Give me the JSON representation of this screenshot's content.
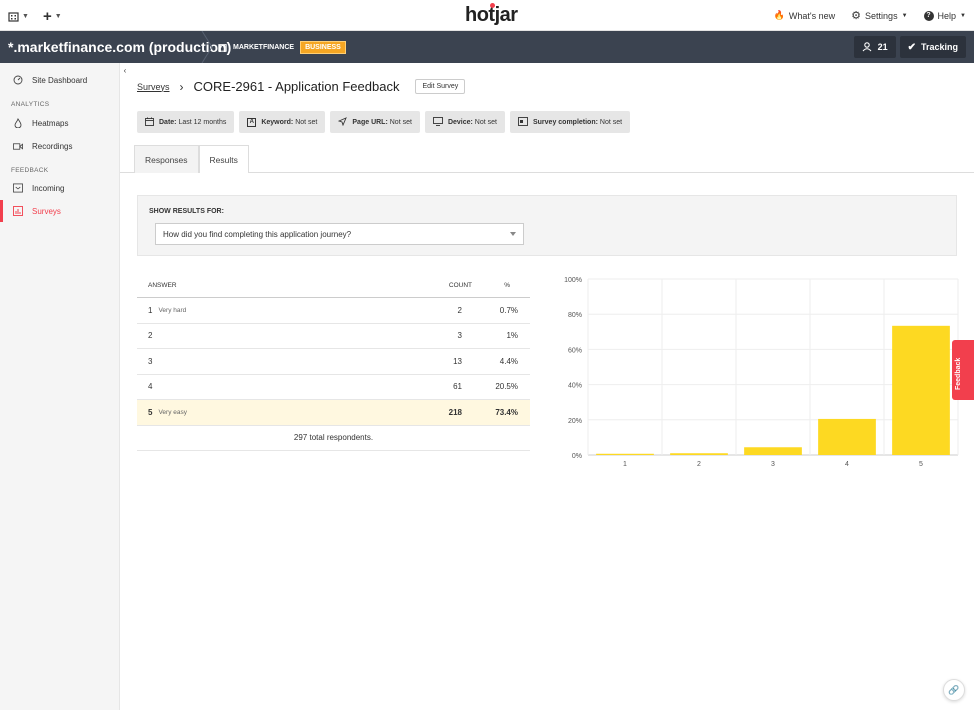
{
  "topbar": {
    "brand": "hotjar",
    "whats_new": "What's new",
    "settings": "Settings",
    "help": "Help"
  },
  "sitebar": {
    "site_name": "*.marketfinance.com (production)",
    "org_name": "MARKETFINANCE",
    "plan_badge": "BUSINESS",
    "users_count": "21",
    "tracking_label": "Tracking"
  },
  "sidebar": {
    "dashboard": "Site Dashboard",
    "analytics_label": "ANALYTICS",
    "heatmaps": "Heatmaps",
    "recordings": "Recordings",
    "feedback_label": "FEEDBACK",
    "incoming": "Incoming",
    "surveys": "Surveys"
  },
  "breadcrumb": {
    "link": "Surveys",
    "title": "CORE-2961 - Application Feedback",
    "edit_button": "Edit Survey"
  },
  "filters": [
    {
      "name": "Date:",
      "value": "Last 12 months"
    },
    {
      "name": "Keyword:",
      "value": "Not set"
    },
    {
      "name": "Page URL:",
      "value": "Not set"
    },
    {
      "name": "Device:",
      "value": "Not set"
    },
    {
      "name": "Survey completion:",
      "value": "Not set"
    }
  ],
  "tabs": {
    "responses": "Responses",
    "results": "Results"
  },
  "results": {
    "label": "SHOW RESULTS FOR:",
    "question": "How did you find completing this application journey?"
  },
  "table": {
    "headers": {
      "answer": "ANSWER",
      "count": "COUNT",
      "pct": "%"
    },
    "rows": [
      {
        "answer": "1",
        "sub": "Very hard",
        "count": "2",
        "pct": "0.7%"
      },
      {
        "answer": "2",
        "sub": "",
        "count": "3",
        "pct": "1%"
      },
      {
        "answer": "3",
        "sub": "",
        "count": "13",
        "pct": "4.4%"
      },
      {
        "answer": "4",
        "sub": "",
        "count": "61",
        "pct": "20.5%"
      },
      {
        "answer": "5",
        "sub": "Very easy",
        "count": "218",
        "pct": "73.4%"
      }
    ],
    "total": "297 total respondents."
  },
  "chart_data": {
    "type": "bar",
    "categories": [
      "1",
      "2",
      "3",
      "4",
      "5"
    ],
    "values": [
      0.7,
      1,
      4.4,
      20.5,
      73.4
    ],
    "yticks": [
      "0%",
      "20%",
      "40%",
      "60%",
      "80%",
      "100%"
    ],
    "ylim": [
      0,
      100
    ],
    "bar_color": "#fdd922",
    "grid": true
  },
  "feedback_tab": "Feedback"
}
